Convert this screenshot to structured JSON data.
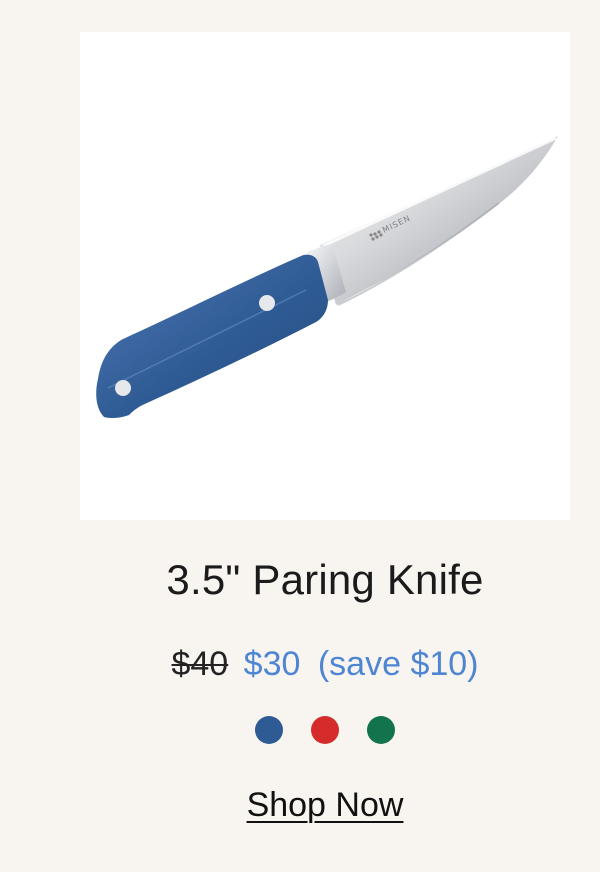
{
  "product": {
    "image_alt": "knife-product-image",
    "brand_mark": "MISEN",
    "title": "3.5\" Paring Knife",
    "price_original": "$40",
    "price_sale": "$30",
    "price_save": "(save $10)",
    "link_label": "Shop Now"
  },
  "colors": {
    "background": "#f8f4f0",
    "card": "#ffffff",
    "accent_price": "#4f86d3",
    "text": "#1b1b1b"
  },
  "swatches": [
    {
      "name": "blue",
      "hex": "#2f5b94"
    },
    {
      "name": "red",
      "hex": "#d52b2b"
    },
    {
      "name": "green",
      "hex": "#12734d"
    }
  ]
}
